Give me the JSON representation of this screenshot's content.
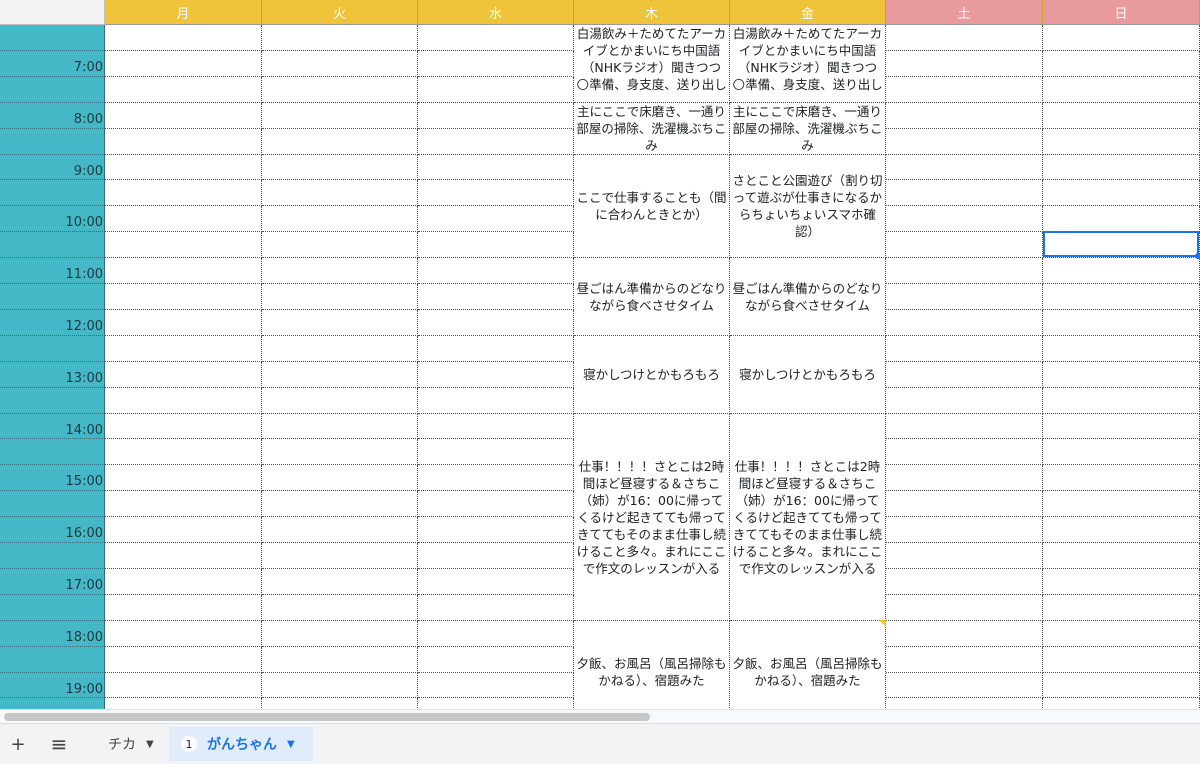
{
  "days": [
    {
      "label": "月",
      "color": "#f0c43a"
    },
    {
      "label": "火",
      "color": "#f0c43a"
    },
    {
      "label": "水",
      "color": "#f0c43a"
    },
    {
      "label": "木",
      "color": "#f0c43a"
    },
    {
      "label": "金",
      "color": "#f0c43a"
    },
    {
      "label": "土",
      "color": "#e99a9c"
    },
    {
      "label": "日",
      "color": "#e99a9c"
    }
  ],
  "times": [
    "7:00",
    "8:00",
    "9:00",
    "10:00",
    "11:00",
    "12:00",
    "13:00",
    "14:00",
    "15:00",
    "16:00",
    "17:00",
    "18:00",
    "19:00"
  ],
  "events": {
    "thu": [
      {
        "id": "thu-morning",
        "text": "白湯飲み＋ためてたアーカイブとかまいにち中国語（NHKラジオ）聞きつつ🌕準備、身支度、送り出し",
        "dot": true,
        "start": 0,
        "span": 3,
        "top": true
      },
      {
        "id": "thu-cleaning",
        "text": "主にここで床磨き、一通り部屋の掃除、洗濯機ぶちこみ",
        "start": 3,
        "span": 2,
        "top": true
      },
      {
        "id": "thu-work-am",
        "text": "ここで仕事することも（間に合わんときとか）",
        "start": 5,
        "span": 4
      },
      {
        "id": "thu-lunch",
        "text": "昼ごはん準備からのどなりながら食べさせタイム",
        "start": 9,
        "span": 3
      },
      {
        "id": "thu-nap",
        "text": "寝かしつけとかもろもろ",
        "start": 12,
        "span": 3
      },
      {
        "id": "thu-work-pm",
        "text": "仕事！！！！さとこは2時間ほど昼寝する＆さちこ（姉）が16：00に帰ってくるけど起きてても帰ってきててもそのまま仕事し続けること多々。まれにここで作文のレッスンが入る",
        "start": 15,
        "span": 8
      },
      {
        "id": "thu-dinner",
        "text": "夕飯、お風呂（風呂掃除もかねる）、宿題みた",
        "start": 23,
        "span": 4
      }
    ],
    "fri": [
      {
        "id": "fri-morning",
        "text": "白湯飲み＋ためてたアーカイブとかまいにち中国語（NHKラジオ）聞きつつ🌕準備、身支度、送り出し",
        "dot": true,
        "start": 0,
        "span": 3,
        "top": true
      },
      {
        "id": "fri-cleaning",
        "text": "主にここで床磨き、一通り部屋の掃除、洗濯機ぶちこみ",
        "start": 3,
        "span": 2,
        "top": true
      },
      {
        "id": "fri-park",
        "text": "さとこと公園遊び（割り切って遊ぶが仕事きになるからちょいちょいスマホ確認）",
        "start": 5,
        "span": 4
      },
      {
        "id": "fri-lunch",
        "text": "昼ごはん準備からのどなりながら食べさせタイム",
        "start": 9,
        "span": 3
      },
      {
        "id": "fri-nap",
        "text": "寝かしつけとかもろもろ",
        "start": 12,
        "span": 3
      },
      {
        "id": "fri-work-pm",
        "text": "仕事！！！！さとこは2時間ほど昼寝する＆さちこ（姉）が16：00に帰ってくるけど起きてても帰ってきててもそのまま仕事し続けること多々。まれにここで作文のレッスンが入る",
        "start": 15,
        "span": 8
      },
      {
        "id": "fri-dinner",
        "text": "夕飯、お風呂（風呂掃除もかねる）、宿題みた",
        "start": 23,
        "span": 4
      }
    ]
  },
  "tabs": {
    "add_label": "+",
    "menu_label": "≡",
    "sheet1": {
      "label": "チカ"
    },
    "sheet2": {
      "label": "がんちゃん",
      "badge": "1"
    }
  },
  "colors": {
    "time_column": "#45b8c8",
    "weekday_header": "#f0c43a",
    "weekend_header": "#e99a9c",
    "selection": "#1a73e8"
  }
}
